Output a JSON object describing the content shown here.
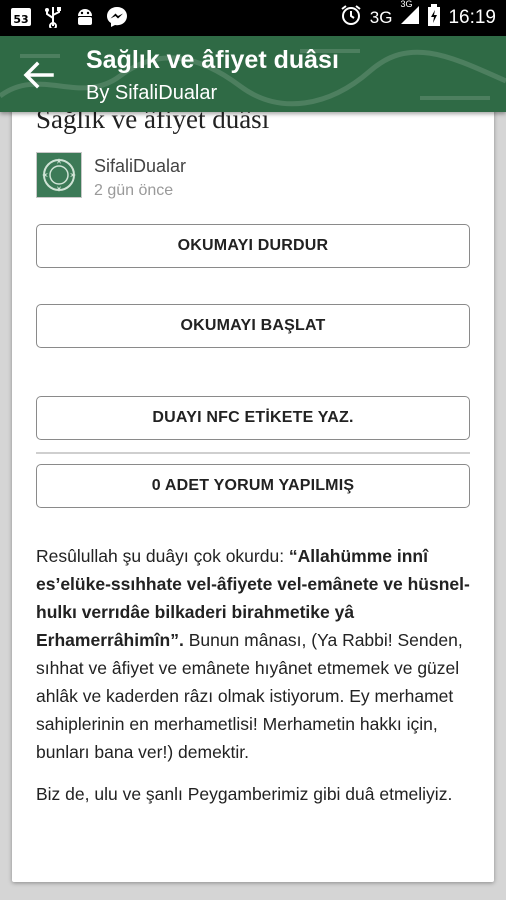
{
  "status_bar": {
    "left_icons": [
      "notification-53-icon",
      "usb-icon",
      "android-debug-icon",
      "messenger-icon"
    ],
    "notification_count": "53",
    "alarm_icon": "alarm-clock-icon",
    "network": "3G",
    "network_small": "3G",
    "time": "16:19"
  },
  "toolbar": {
    "title": "Sağlık ve âfiyet duâsı",
    "subtitle": "By SifaliDualar",
    "color": "#2f6a45"
  },
  "post": {
    "title": "Sağlık ve âfiyet duâsı",
    "author": "SifaliDualar",
    "time_ago": "2 gün önce"
  },
  "buttons": {
    "stop_reading": "OKUMAYI DURDUR",
    "start_reading": "OKUMAYI BAŞLAT",
    "write_nfc": "DUAYI NFC ETİKETE YAZ.",
    "comments": "0 ADET YORUM YAPILMIŞ"
  },
  "article": {
    "p1_intro": "Resûlullah şu duâyı çok okurdu: ",
    "p1_bold": "“Allahümme innî es’elüke-ssıhhate vel-âfiyete vel-emânete ve hüsnel-hulkı verrıdâe bilkaderi birahmetike yâ Erhamerrâhimîn”.",
    "p1_rest": " Bunun mânası, (Ya Rabbi! Senden, sıhhat ve âfiyet ve emânete hıyânet etmemek ve güzel ahlâk ve kaderden râzı olmak istiyorum. Ey merhamet sahiplerinin en merhametlisi! Merhametin hakkı için, bunları bana ver!) demektir.",
    "p2": "Biz de, ulu ve şanlı Peygamberimiz gibi duâ etmeliyiz."
  }
}
